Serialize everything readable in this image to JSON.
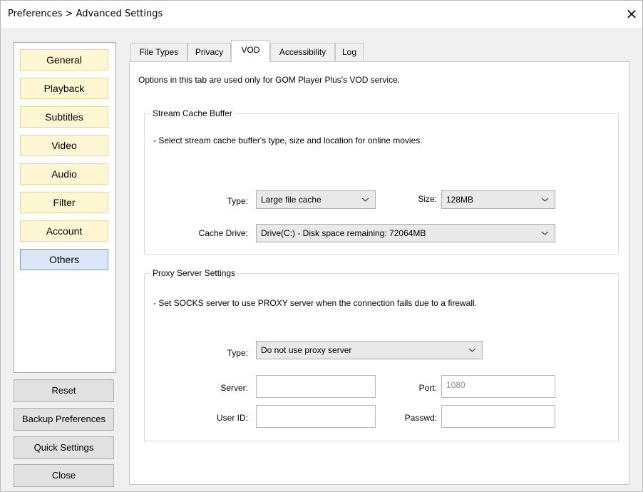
{
  "window": {
    "title": "Preferences > Advanced Settings",
    "close_glyph": "✕"
  },
  "sidebar": {
    "categories": [
      {
        "label": "General",
        "active": false
      },
      {
        "label": "Playback",
        "active": false
      },
      {
        "label": "Subtitles",
        "active": false
      },
      {
        "label": "Video",
        "active": false
      },
      {
        "label": "Audio",
        "active": false
      },
      {
        "label": "Filter",
        "active": false
      },
      {
        "label": "Account",
        "active": false
      },
      {
        "label": "Others",
        "active": true
      }
    ],
    "buttons": [
      "Reset",
      "Backup Preferences",
      "Quick Settings",
      "Close"
    ]
  },
  "tabs": [
    {
      "label": "File Types",
      "active": false
    },
    {
      "label": "Privacy",
      "active": false
    },
    {
      "label": "VOD",
      "active": true
    },
    {
      "label": "Accessibility",
      "active": false
    },
    {
      "label": "Log",
      "active": false
    }
  ],
  "vod": {
    "intro": "Options in this tab are used only for GOM Player Plus's VOD service.",
    "cache": {
      "title": "Stream Cache Buffer",
      "desc": "-   Select stream cache buffer's type, size and location for online movies.",
      "type_label": "Type:",
      "type_value": "Large file cache",
      "size_label": "Size:",
      "size_value": "128MB",
      "drive_label": "Cache Drive:",
      "drive_value": "Drive(C:) - Disk space remaining:  72064MB"
    },
    "proxy": {
      "title": "Proxy Server Settings",
      "desc": "-   Set SOCKS server to use PROXY server when the connection fails due to a firewall.",
      "type_label": "Type:",
      "type_value": "Do not use proxy server",
      "server_label": "Server:",
      "server_value": "",
      "port_label": "Port:",
      "port_value": "1080",
      "userid_label": "User ID:",
      "userid_value": "",
      "passwd_label": "Passwd:",
      "passwd_value": ""
    }
  },
  "colors": {
    "category_bg": "#fff6d4",
    "category_active_bg": "#dbe6f6",
    "button_bg": "#e1e1e1"
  }
}
